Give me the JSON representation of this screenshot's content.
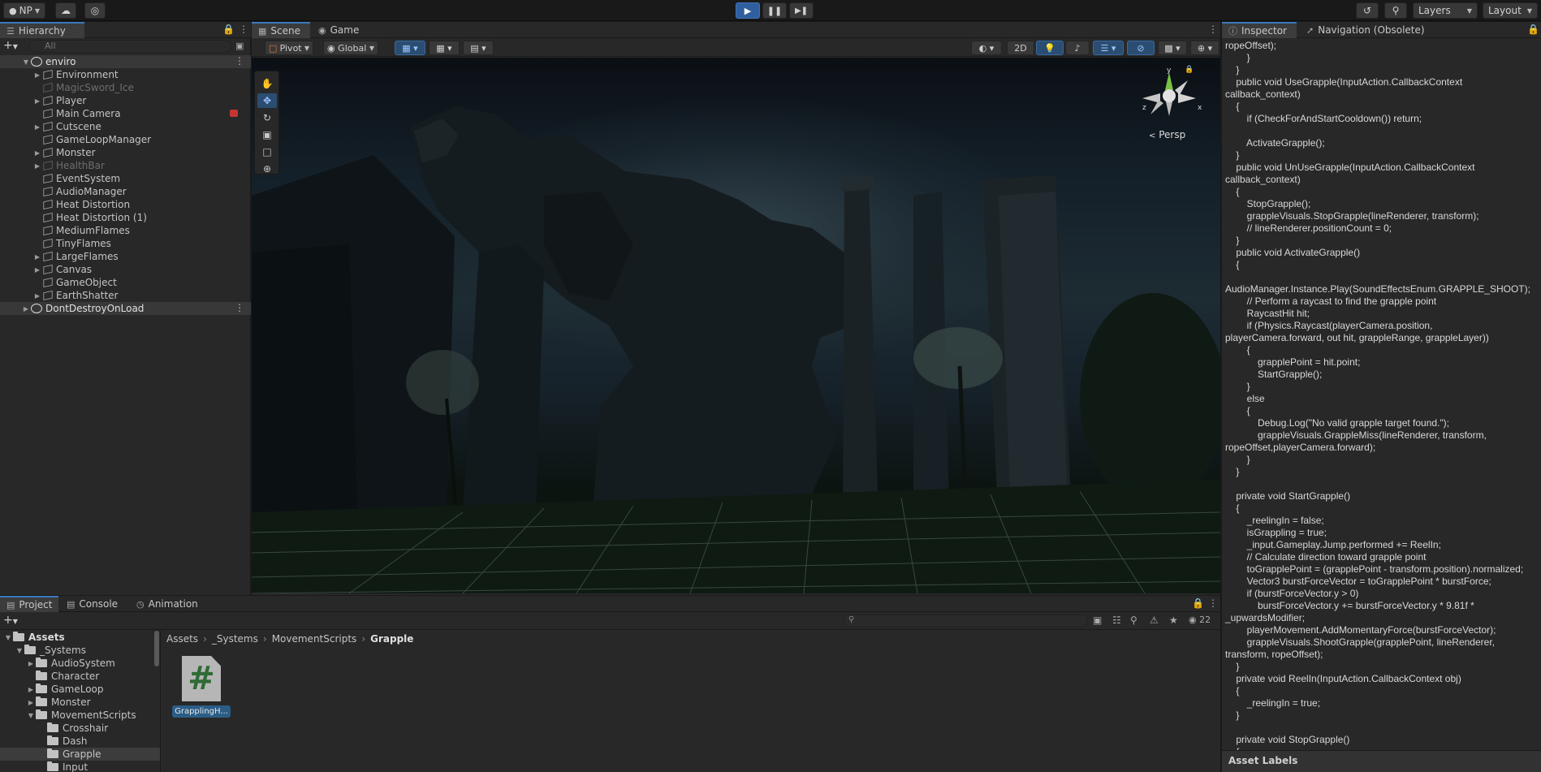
{
  "toolbar": {
    "account_label": "NP",
    "layers_label": "Layers",
    "layout_label": "Layout"
  },
  "hierarchy": {
    "title": "Hierarchy",
    "search_placeholder": "All",
    "scene_name": "enviro",
    "items": [
      {
        "label": "Environment",
        "expandable": true,
        "dim": false
      },
      {
        "label": "MagicSword_Ice",
        "expandable": false,
        "dim": true
      },
      {
        "label": "Player",
        "expandable": true,
        "dim": false
      },
      {
        "label": "Main Camera",
        "expandable": false,
        "dim": false
      },
      {
        "label": "Cutscene",
        "expandable": true,
        "dim": false
      },
      {
        "label": "GameLoopManager",
        "expandable": false,
        "dim": false
      },
      {
        "label": "Monster",
        "expandable": true,
        "dim": false
      },
      {
        "label": "HealthBar",
        "expandable": true,
        "dim": true
      },
      {
        "label": "EventSystem",
        "expandable": false,
        "dim": false
      },
      {
        "label": "AudioManager",
        "expandable": false,
        "dim": false
      },
      {
        "label": "Heat Distortion",
        "expandable": false,
        "dim": false
      },
      {
        "label": "Heat Distortion (1)",
        "expandable": false,
        "dim": false
      },
      {
        "label": "MediumFlames",
        "expandable": false,
        "dim": false
      },
      {
        "label": "TinyFlames",
        "expandable": false,
        "dim": false
      },
      {
        "label": "LargeFlames",
        "expandable": true,
        "dim": false
      },
      {
        "label": "Canvas",
        "expandable": true,
        "dim": false
      },
      {
        "label": "GameObject",
        "expandable": false,
        "dim": false
      },
      {
        "label": "EarthShatter",
        "expandable": true,
        "dim": false
      }
    ],
    "dont_destroy_label": "DontDestroyOnLoad"
  },
  "scene": {
    "tab_scene": "Scene",
    "tab_game": "Game",
    "pivot_label": "Pivot",
    "global_label": "Global",
    "mode_2d_label": "2D",
    "persp_label": "Persp",
    "gizmo_axes": {
      "y": "y",
      "x": "x",
      "z": "z"
    }
  },
  "inspector": {
    "tab_inspector": "Inspector",
    "tab_navigation": "Navigation (Obsolete)",
    "code_lines": [
      "ropeOffset);",
      "        }",
      "    }",
      "    public void UseGrapple(InputAction.CallbackContext",
      "callback_context)",
      "    {",
      "        if (CheckForAndStartCooldown()) return;",
      "",
      "        ActivateGrapple();",
      "    }",
      "    public void UnUseGrapple(InputAction.CallbackContext",
      "callback_context)",
      "    {",
      "        StopGrapple();",
      "        grappleVisuals.StopGrapple(lineRenderer, transform);",
      "        // lineRenderer.positionCount = 0;",
      "    }",
      "    public void ActivateGrapple()",
      "    {",
      "",
      "AudioManager.Instance.Play(SoundEffectsEnum.GRAPPLE_SHOOT);",
      "        // Perform a raycast to find the grapple point",
      "        RaycastHit hit;",
      "        if (Physics.Raycast(playerCamera.position,",
      "playerCamera.forward, out hit, grappleRange, grappleLayer))",
      "        {",
      "            grapplePoint = hit.point;",
      "            StartGrapple();",
      "        }",
      "        else",
      "        {",
      "            Debug.Log(\"No valid grapple target found.\");",
      "            grappleVisuals.GrappleMiss(lineRenderer, transform,",
      "ropeOffset,playerCamera.forward);",
      "        }",
      "    }",
      "",
      "    private void StartGrapple()",
      "    {",
      "        _reelingIn = false;",
      "        isGrappling = true;",
      "        _input.Gameplay.Jump.performed += ReelIn;",
      "        // Calculate direction toward grapple point",
      "        toGrapplePoint = (grapplePoint - transform.position).normalized;",
      "        Vector3 burstForceVector = toGrapplePoint * burstForce;",
      "        if (burstForceVector.y > 0)",
      "            burstForceVector.y += burstForceVector.y * 9.81f *",
      "_upwardsModifier;",
      "        playerMovement.AddMomentaryForce(burstForceVector);",
      "        grappleVisuals.ShootGrapple(grapplePoint, lineRenderer,",
      "transform, ropeOffset);",
      "    }",
      "    private void ReelIn(InputAction.CallbackContext obj)",
      "    {",
      "        _reelingIn = true;",
      "    }",
      "",
      "    private void StopGrapple()",
      "    {"
    ],
    "asset_labels": "Asset Labels"
  },
  "project": {
    "tab_project": "Project",
    "tab_console": "Console",
    "tab_animation": "Animation",
    "hidden_count": "22",
    "tree": [
      {
        "label": "Assets",
        "depth": 0,
        "arrow": "open",
        "bold": true,
        "sel": false
      },
      {
        "label": "_Systems",
        "depth": 1,
        "arrow": "open",
        "bold": false,
        "sel": false
      },
      {
        "label": "AudioSystem",
        "depth": 2,
        "arrow": "closed",
        "bold": false,
        "sel": false
      },
      {
        "label": "Character",
        "depth": 2,
        "arrow": "none",
        "bold": false,
        "sel": false
      },
      {
        "label": "GameLoop",
        "depth": 2,
        "arrow": "closed",
        "bold": false,
        "sel": false
      },
      {
        "label": "Monster",
        "depth": 2,
        "arrow": "closed",
        "bold": false,
        "sel": false
      },
      {
        "label": "MovementScripts",
        "depth": 2,
        "arrow": "open",
        "bold": false,
        "sel": false
      },
      {
        "label": "Crosshair",
        "depth": 3,
        "arrow": "none",
        "bold": false,
        "sel": false
      },
      {
        "label": "Dash",
        "depth": 3,
        "arrow": "none",
        "bold": false,
        "sel": false
      },
      {
        "label": "Grapple",
        "depth": 3,
        "arrow": "none",
        "bold": false,
        "sel": true
      },
      {
        "label": "Input",
        "depth": 3,
        "arrow": "none",
        "bold": false,
        "sel": false
      }
    ],
    "breadcrumb": [
      "Assets",
      "_Systems",
      "MovementScripts",
      "Grapple"
    ],
    "asset": {
      "icon_glyph": "#",
      "name": "GrapplingH..."
    }
  }
}
